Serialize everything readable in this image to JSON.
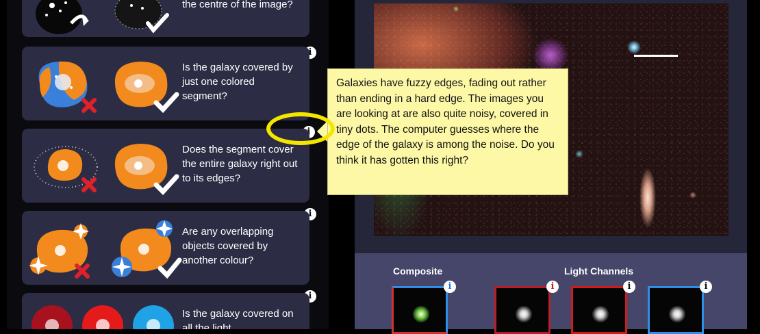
{
  "questions": [
    {
      "text": "the centre of the image?"
    },
    {
      "text": "Is the galaxy covered by just one colored segment?"
    },
    {
      "text": "Does the segment cover the entire galaxy right out to its edges?"
    },
    {
      "text": "Are any overlapping objects covered by another colour?"
    },
    {
      "text": "Is the galaxy covered on all the light"
    }
  ],
  "icons": {
    "info": "i",
    "wrong": "red-x-icon",
    "right": "white-check-icon"
  },
  "tooltip": {
    "text": "Galaxies have fuzzy edges, fading out rather than ending in a hard edge. The images you are looking at are also quite noisy, covered in tiny dots. The computer guesses where the edge of the galaxy is among the noise. Do you think it has gotten this right?"
  },
  "viewer": {
    "composite_label": "Composite",
    "channels_label": "Light Channels"
  },
  "colors": {
    "card": "#2c2d44",
    "tooltip": "#fdf8a6",
    "highlight": "#f5e600",
    "segment_orange": "#f28a1e",
    "segment_blue": "#3a7fd9",
    "cross_red": "#e0202a"
  }
}
